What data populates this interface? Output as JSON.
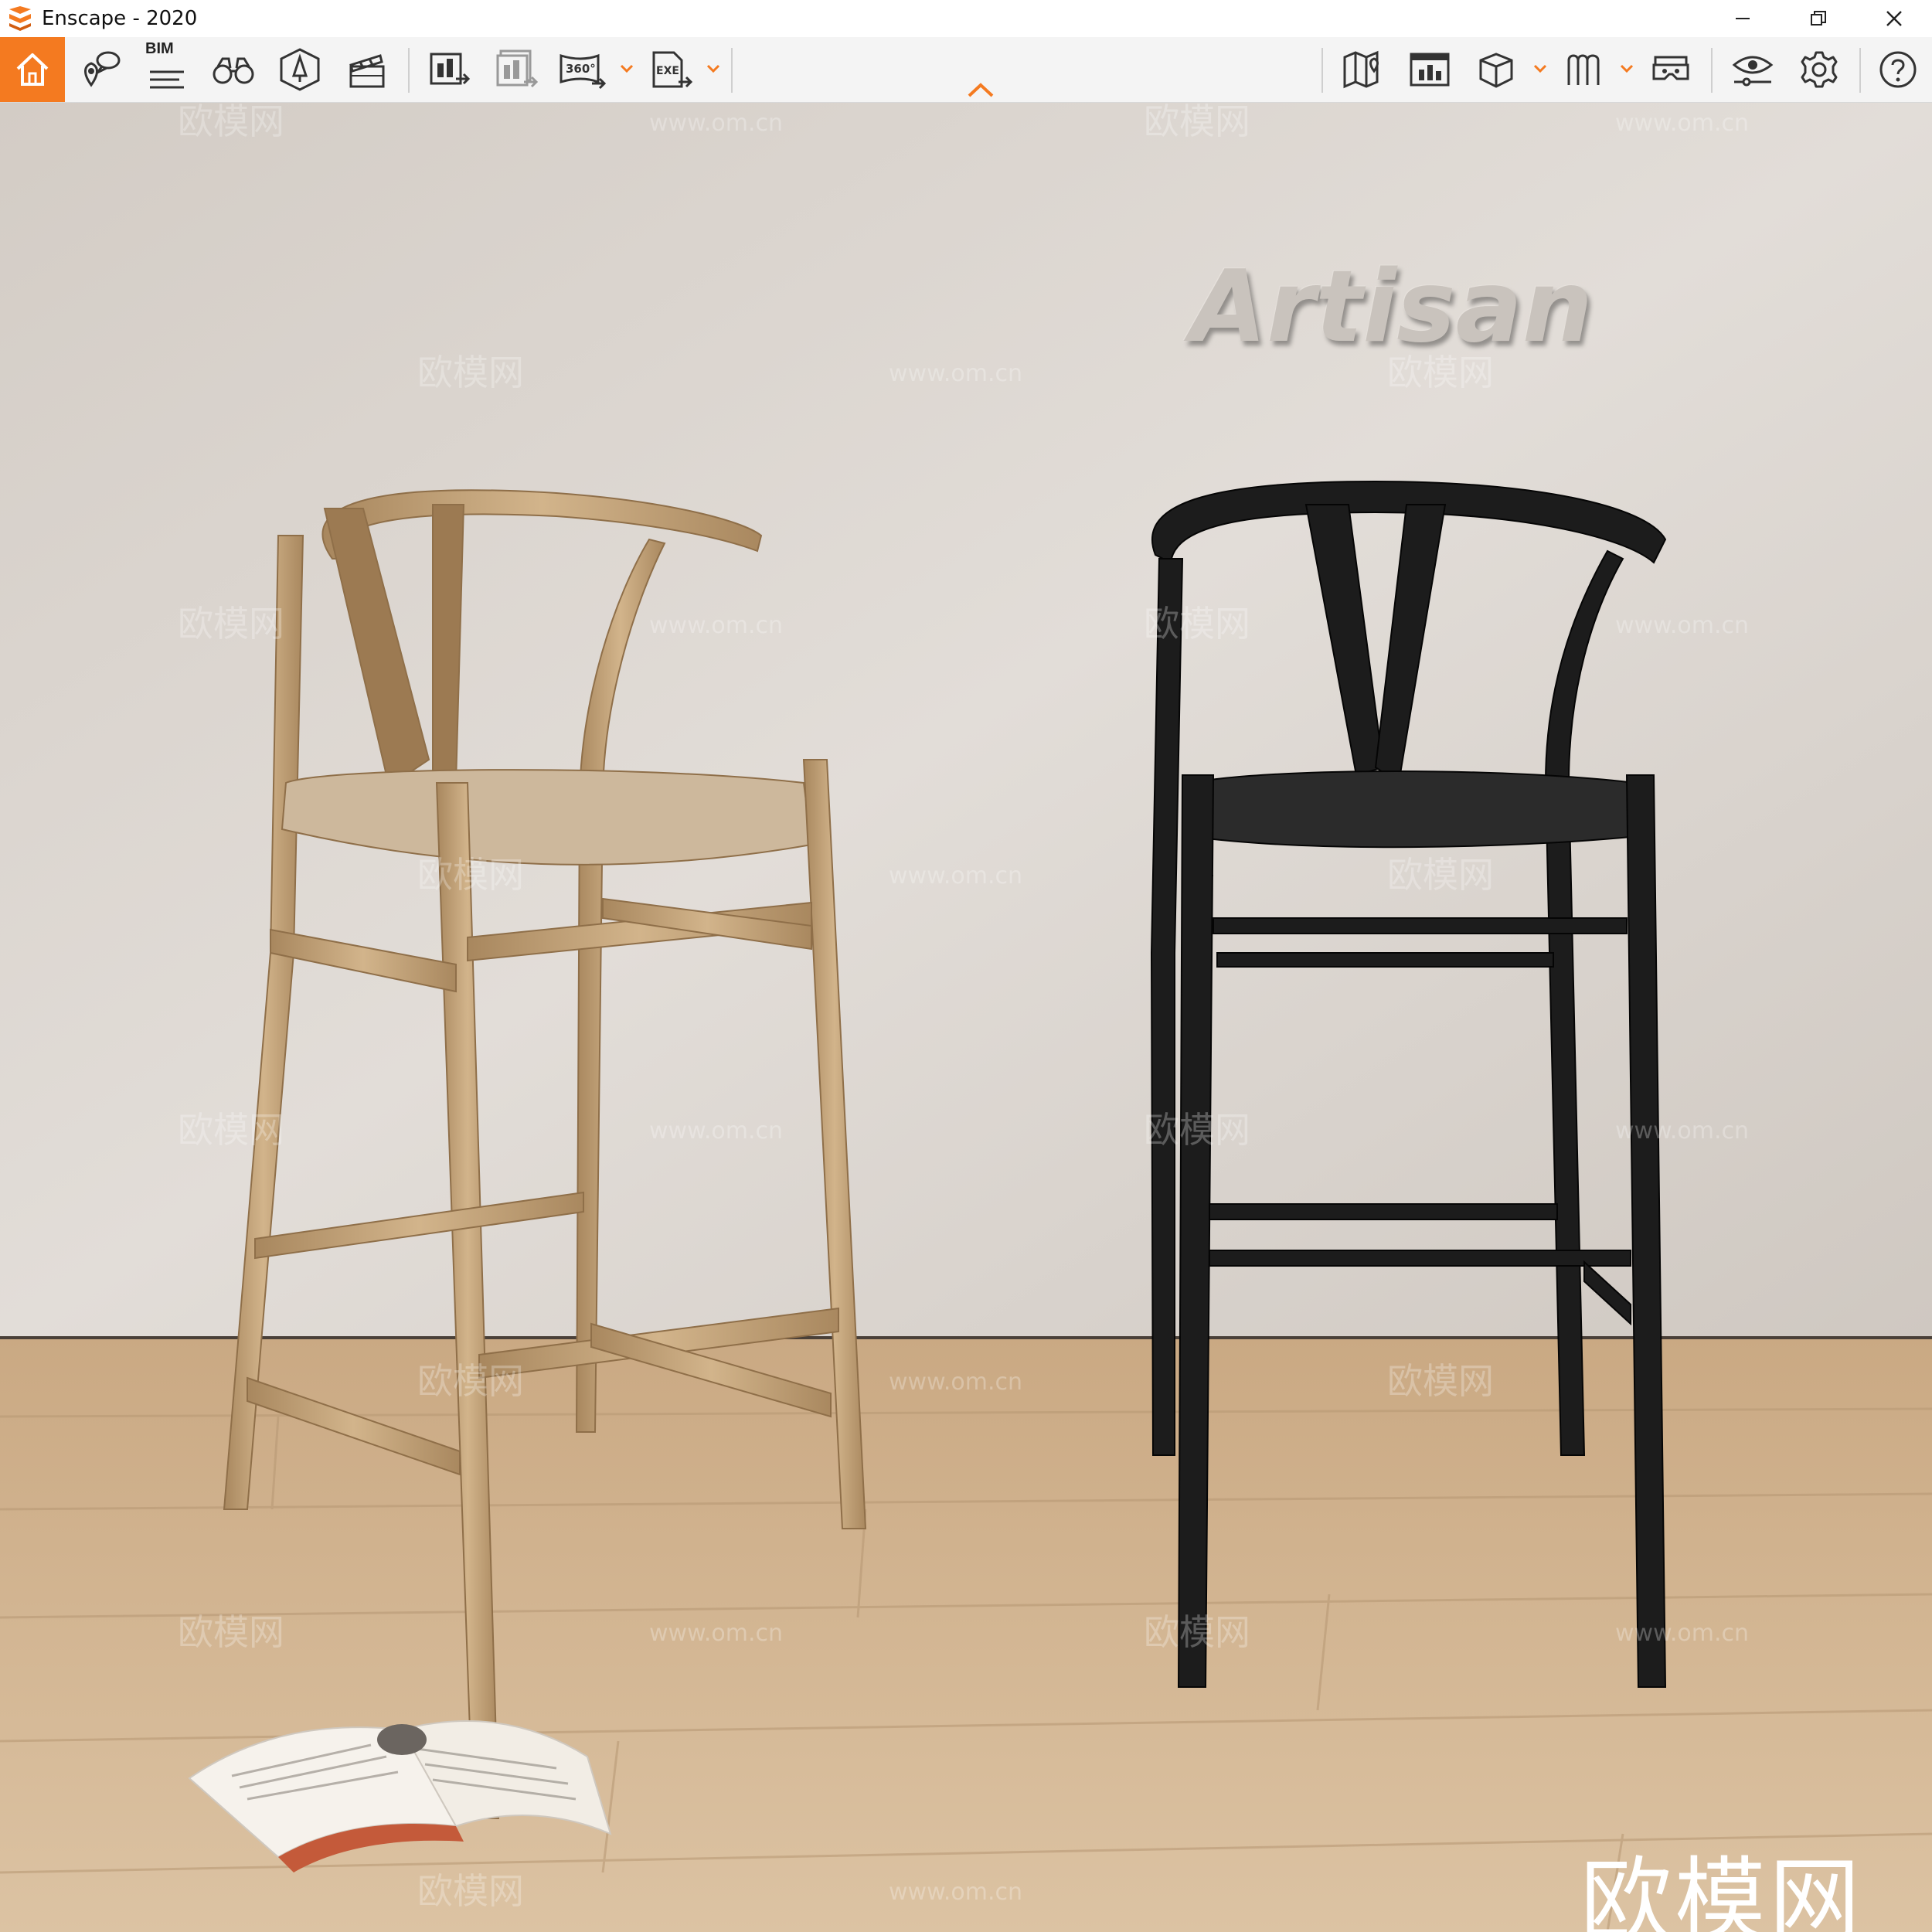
{
  "window": {
    "title": "Enscape - 2020",
    "controls": [
      "minimize",
      "restore",
      "close"
    ]
  },
  "toolbar": {
    "bim_label": "BIM",
    "panorama_label": "360°",
    "exe_label": "EXE",
    "accent_color": "#f47a20",
    "left_tools": [
      "home-icon",
      "views-icon",
      "bim-info-icon",
      "binoculars-icon",
      "asset-library-icon",
      "video-editor-icon"
    ],
    "export_tools": [
      "screenshot-export-icon",
      "batch-render-icon",
      "panorama-export-icon",
      "exe-export-icon"
    ],
    "right_tools": [
      "map-icon",
      "render-window-icon",
      "cube-view-icon",
      "walk-mode-icon",
      "vr-headset-icon",
      "visual-settings-icon",
      "settings-icon",
      "help-icon"
    ]
  },
  "scene": {
    "wall_sign": "Artisan",
    "watermark_text": "欧模网",
    "watermark_url": "www.om.cn",
    "brand_mark": "欧模网",
    "colors": {
      "wall": "#dcd7d1",
      "floor": "#d3b897",
      "oak_chair": "#c4a57c",
      "black_chair": "#1c1c1c"
    }
  }
}
